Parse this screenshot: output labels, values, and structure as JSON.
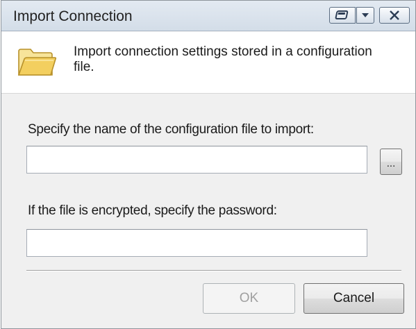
{
  "window": {
    "title": "Import Connection"
  },
  "title_controls": {
    "restore_icon": "restore-icon",
    "menu_icon": "chevron-down-icon",
    "close_icon": "close-icon"
  },
  "header": {
    "icon": "folder-open-icon",
    "description": "Import connection settings stored in a configuration file."
  },
  "form": {
    "file_label": "Specify the name of the configuration file to import:",
    "file_value": "",
    "browse_label": "...",
    "password_label": "If the file is encrypted, specify the password:",
    "password_value": ""
  },
  "buttons": {
    "ok_label": "OK",
    "ok_enabled": false,
    "cancel_label": "Cancel"
  },
  "colors": {
    "titlebar": "#dbe3ec",
    "body": "#f0f0f0",
    "header_bg": "#ffffff",
    "folder": "#f3d36b",
    "disabled_text": "#a0a0a0"
  }
}
